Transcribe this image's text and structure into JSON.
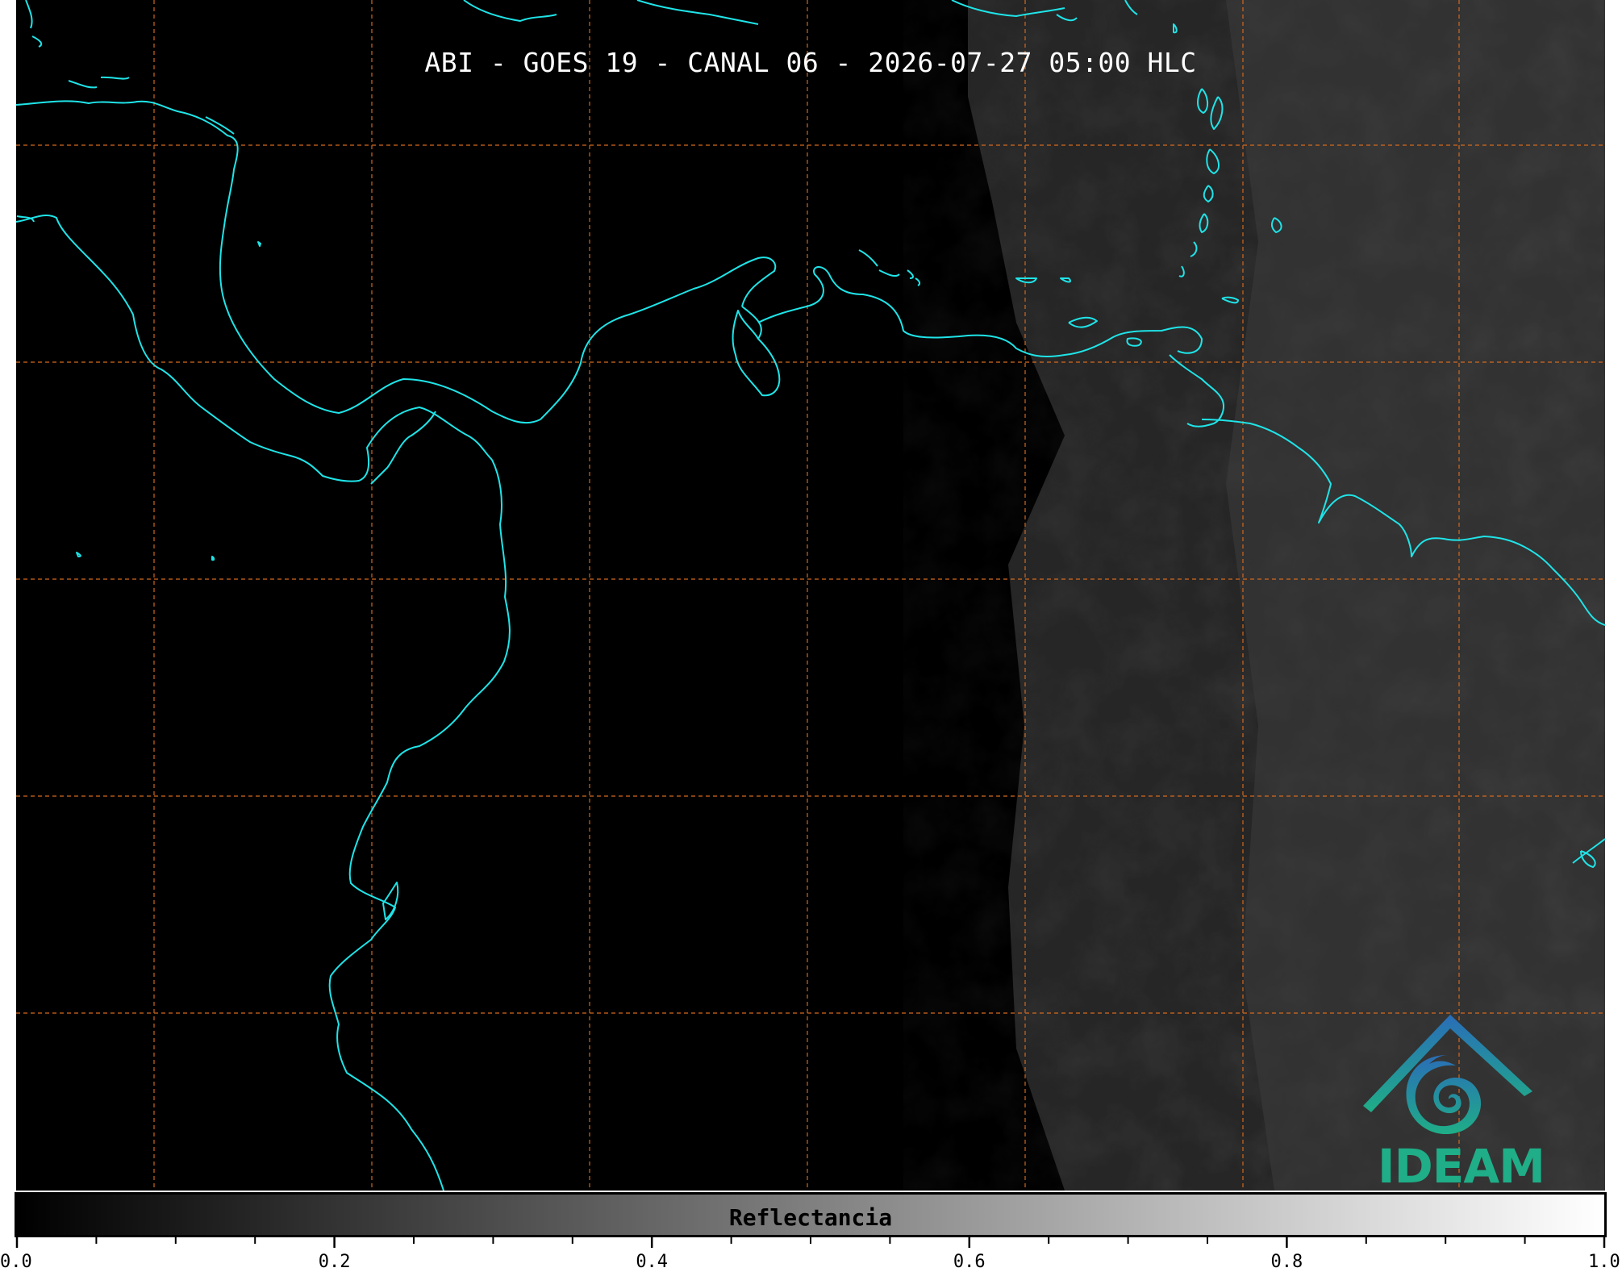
{
  "title": "ABI - GOES 19 - CANAL 06 - 2026-07-27 05:00 HLC",
  "colors": {
    "background": "#000000",
    "coastline": "#1fe4e8",
    "gridlines": "#d2691e",
    "logo_blue": "#2a7db8",
    "logo_green": "#1fae87"
  },
  "logo": {
    "text": "IDEAM"
  },
  "colorbar": {
    "label": "Reflectancia",
    "range": [
      0.0,
      1.0
    ],
    "colormap": "grayscale",
    "tick_labels": [
      "0.0",
      "0.2",
      "0.4",
      "0.6",
      "0.8",
      "1.0"
    ],
    "tick_values": [
      0.0,
      0.2,
      0.4,
      0.6,
      0.8,
      1.0
    ],
    "minor_tick_step": 0.05
  },
  "map": {
    "projection_grid": "dashed",
    "coastlines": true
  }
}
